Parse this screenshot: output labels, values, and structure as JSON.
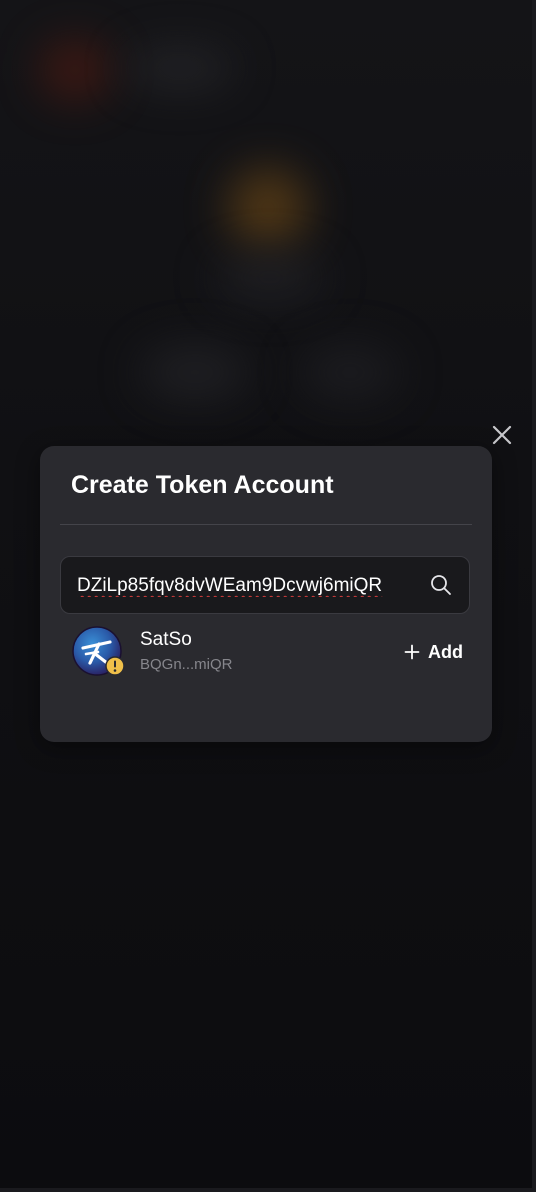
{
  "modal": {
    "title": "Create Token Account",
    "search": {
      "value": "DZiLp85fqv8dvWEam9Dcvwj6miQR",
      "placeholder": ""
    },
    "results": [
      {
        "name": "SatSo",
        "address": "BQGn...miQR",
        "add_label": "Add",
        "warning_badge": "!"
      }
    ]
  },
  "icons": {
    "close": "close-icon",
    "search": "search-icon",
    "plus": "plus-icon",
    "warning": "warning-badge-icon"
  },
  "colors": {
    "background": "#0d0d10",
    "modal": "#2a2a2f",
    "input": "#19191c",
    "muted_text": "#86868c",
    "warning": "#f0c04a"
  }
}
